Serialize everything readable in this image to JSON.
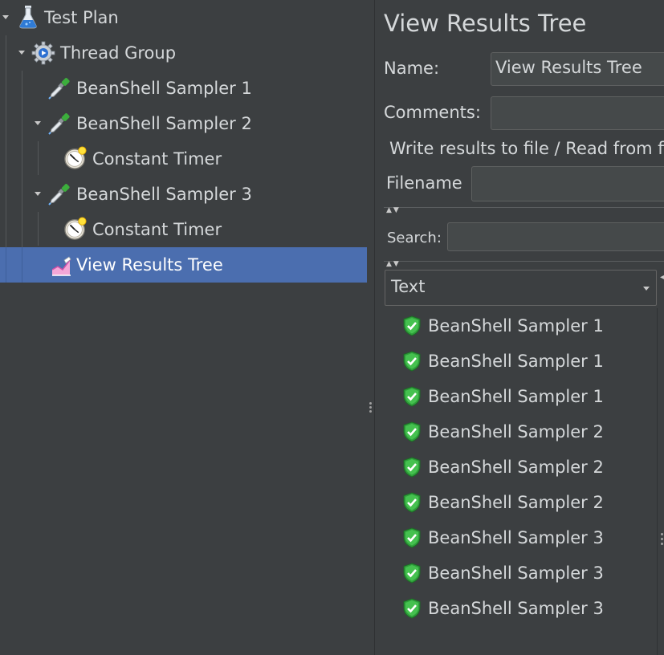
{
  "tree": {
    "items": [
      {
        "label": "Test Plan",
        "icon": "flask-icon"
      },
      {
        "label": "Thread Group",
        "icon": "gear-icon"
      },
      {
        "label": "BeanShell Sampler 1",
        "icon": "dropper-icon"
      },
      {
        "label": "BeanShell Sampler 2",
        "icon": "dropper-icon"
      },
      {
        "label": "Constant Timer",
        "icon": "timer-icon"
      },
      {
        "label": "BeanShell Sampler 3",
        "icon": "dropper-icon"
      },
      {
        "label": "Constant Timer",
        "icon": "timer-icon"
      },
      {
        "label": "View Results Tree",
        "icon": "graph-icon"
      }
    ],
    "selected_index": 7
  },
  "panel": {
    "title": "View Results Tree",
    "name_label": "Name:",
    "name_value": "View Results Tree",
    "comments_label": "Comments:",
    "comments_value": "",
    "write_results_label": "Write results to file / Read from file",
    "filename_label": "Filename",
    "filename_value": "",
    "search_label": "Search:",
    "search_value": "",
    "renderer_selected": "Text",
    "results": [
      {
        "label": "BeanShell Sampler 1",
        "status": "success"
      },
      {
        "label": "BeanShell Sampler 1",
        "status": "success"
      },
      {
        "label": "BeanShell Sampler 1",
        "status": "success"
      },
      {
        "label": "BeanShell Sampler 2",
        "status": "success"
      },
      {
        "label": "BeanShell Sampler 2",
        "status": "success"
      },
      {
        "label": "BeanShell Sampler 2",
        "status": "success"
      },
      {
        "label": "BeanShell Sampler 3",
        "status": "success"
      },
      {
        "label": "BeanShell Sampler 3",
        "status": "success"
      },
      {
        "label": "BeanShell Sampler 3",
        "status": "success"
      }
    ]
  },
  "colors": {
    "background": "#3c3f41",
    "selection": "#4b6eaf",
    "text": "#d5d8da",
    "success": "#3fbf3f"
  }
}
